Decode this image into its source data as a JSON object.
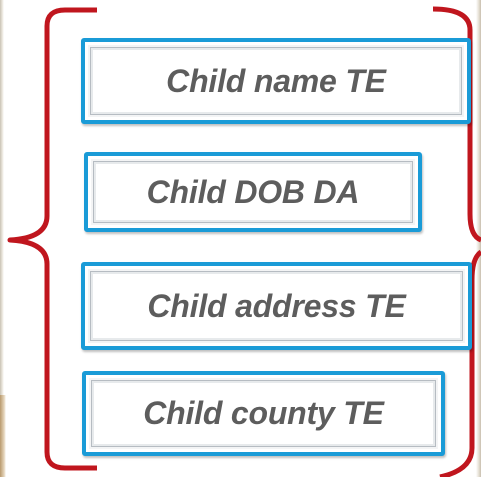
{
  "fields": [
    {
      "id": "name",
      "label": "Child name TE"
    },
    {
      "id": "dob",
      "label": "Child DOB DA"
    },
    {
      "id": "address",
      "label": "Child address TE"
    },
    {
      "id": "county",
      "label": "Child county TE"
    }
  ],
  "colors": {
    "bracket": "#c0161e",
    "box_border": "#1a9bd7",
    "label_text": "#5d5d5d"
  }
}
